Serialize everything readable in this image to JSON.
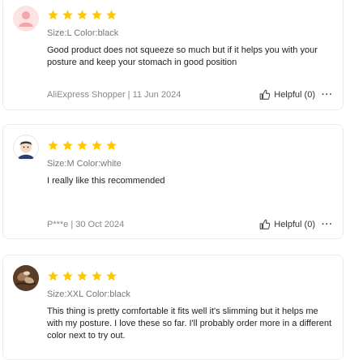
{
  "reviews": [
    {
      "rating": 5,
      "avatar_icon": "user-silhouette-icon",
      "meta": "Size:L Color:black",
      "text": "Good product does not squeeze so much but if it helps you with your posture and keep your stomach in good position",
      "footer": "AliExpress Shopper | 11 Jun 2024",
      "helpful_label": "Helpful (0)",
      "more_icon": "more-dots-icon"
    },
    {
      "rating": 5,
      "avatar_icon": "cartoon-avatar-icon",
      "meta": "Size:M Color:white",
      "text": "I really like this recommended",
      "footer": "P***e | 30 Oct 2024",
      "helpful_label": "Helpful (0)",
      "more_icon": "more-dots-icon"
    },
    {
      "rating": 5,
      "avatar_icon": "photo-avatar-icon",
      "meta": "Size:XXL Color:black",
      "text": "This thing is pretty comfortable it fits well it's slimming but it helps me with my posture. I love these so far. I'll probably order more in a different color next to try out.",
      "footer": "",
      "helpful_label": "",
      "more_icon": ""
    }
  ],
  "colors": {
    "star": "#FFC700",
    "border": "#ececec",
    "avatar_pink_bg": "#fde3e3",
    "avatar_pink_fg": "#f3a7a7"
  }
}
